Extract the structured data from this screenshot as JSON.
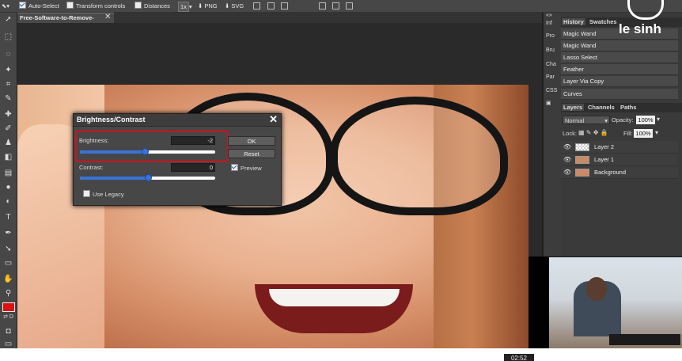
{
  "toolbar": {
    "auto_select": "Auto-Select",
    "transform_controls": "Transform controls",
    "distances": "Distances",
    "zoom": "1x",
    "png": "PNG",
    "svg": "SVG"
  },
  "document_tab": {
    "label": "Free-Software-to-Remove-",
    "close": "✕"
  },
  "side_strip": [
    "Inf",
    "Pro",
    "Bru",
    "Cha",
    "Par",
    "CSS"
  ],
  "history_panel": {
    "tabs": [
      "History",
      "Swatches"
    ],
    "items": [
      "Magic Wand",
      "Magic Wand",
      "Lasso Select",
      "Feather",
      "Layer Via Copy",
      "Curves"
    ]
  },
  "layers_panel": {
    "tabs": [
      "Layers",
      "Channels",
      "Paths"
    ],
    "blend_mode": "Normal",
    "opacity_label": "Opacity:",
    "opacity_value": "100%",
    "lock_label": "Lock:",
    "fill_label": "Fill:",
    "fill_value": "100%",
    "layers": [
      "Layer 2",
      "Layer 1",
      "Background"
    ]
  },
  "dialog": {
    "title": "Brightness/Contrast",
    "brightness_label": "Brightness:",
    "brightness_value": "-2",
    "brightness_level": 0.48,
    "contrast_label": "Contrast:",
    "contrast_value": "0",
    "contrast_level": 0.5,
    "ok": "OK",
    "reset": "Reset",
    "preview": "Preview",
    "use_legacy": "Use Legacy"
  },
  "logo": {
    "text": "le sinh"
  },
  "video": {
    "timestamp": "02:52"
  },
  "colors": {
    "accent": "#3a72d8",
    "highlight": "#d0121a",
    "foreground_swatch": "#e01010"
  }
}
